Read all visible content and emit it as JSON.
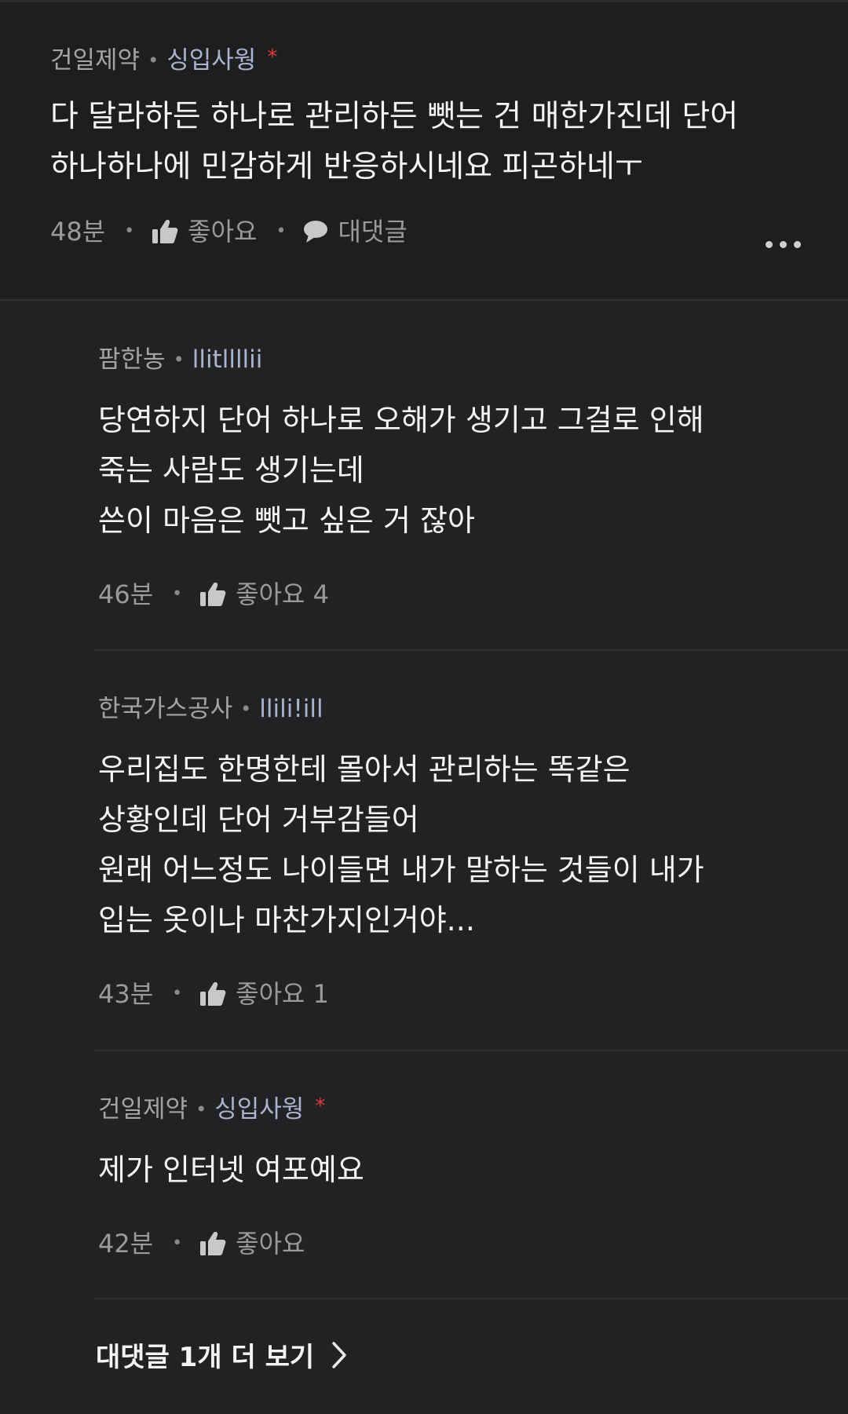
{
  "main_comment": {
    "company": "건일제약",
    "author": "싱입사웡",
    "star": "*",
    "lines": [
      "다 달라하든 하나로 관리하든 뺏는 건 매한가진데 단어",
      "하나하나에 민감하게 반응하시네요 피곤하네ㅜ"
    ],
    "time": "48분",
    "like_label": "좋아요",
    "reply_label": "대댓글",
    "more_icon": "more-horizontal-icon"
  },
  "replies": [
    {
      "company": "팜한농",
      "author": "llitllllii",
      "lines": [
        "당연하지 단어 하나로 오해가 생기고 그걸로 인해",
        "죽는 사람도 생기는데",
        "쓴이 마음은 뺏고 싶은 거 잖아"
      ],
      "time": "46분",
      "like_label": "좋아요 4"
    },
    {
      "company": "한국가스공사",
      "author": "llili!ill",
      "lines": [
        "우리집도 한명한테 몰아서 관리하는 똑같은",
        "상황인데 단어 거부감들어",
        "원래 어느정도 나이들면 내가 말하는 것들이 내가",
        "입는 옷이나 마찬가지인거야..."
      ],
      "time": "43분",
      "like_label": "좋아요 1"
    },
    {
      "company": "건일제약",
      "author": "싱입사웡",
      "star": "*",
      "lines": [
        "제가 인터넷 여포예요"
      ],
      "time": "42분",
      "like_label": "좋아요"
    }
  ],
  "see_more": {
    "label": "대댓글 1개 더 보기",
    "icon": "chevron-right-icon"
  },
  "colors": {
    "background": "#1e1e1f",
    "reply_background": "#222224",
    "author": "#aab4cf",
    "star": "#e03b3b",
    "muted": "#9a9a9c"
  }
}
